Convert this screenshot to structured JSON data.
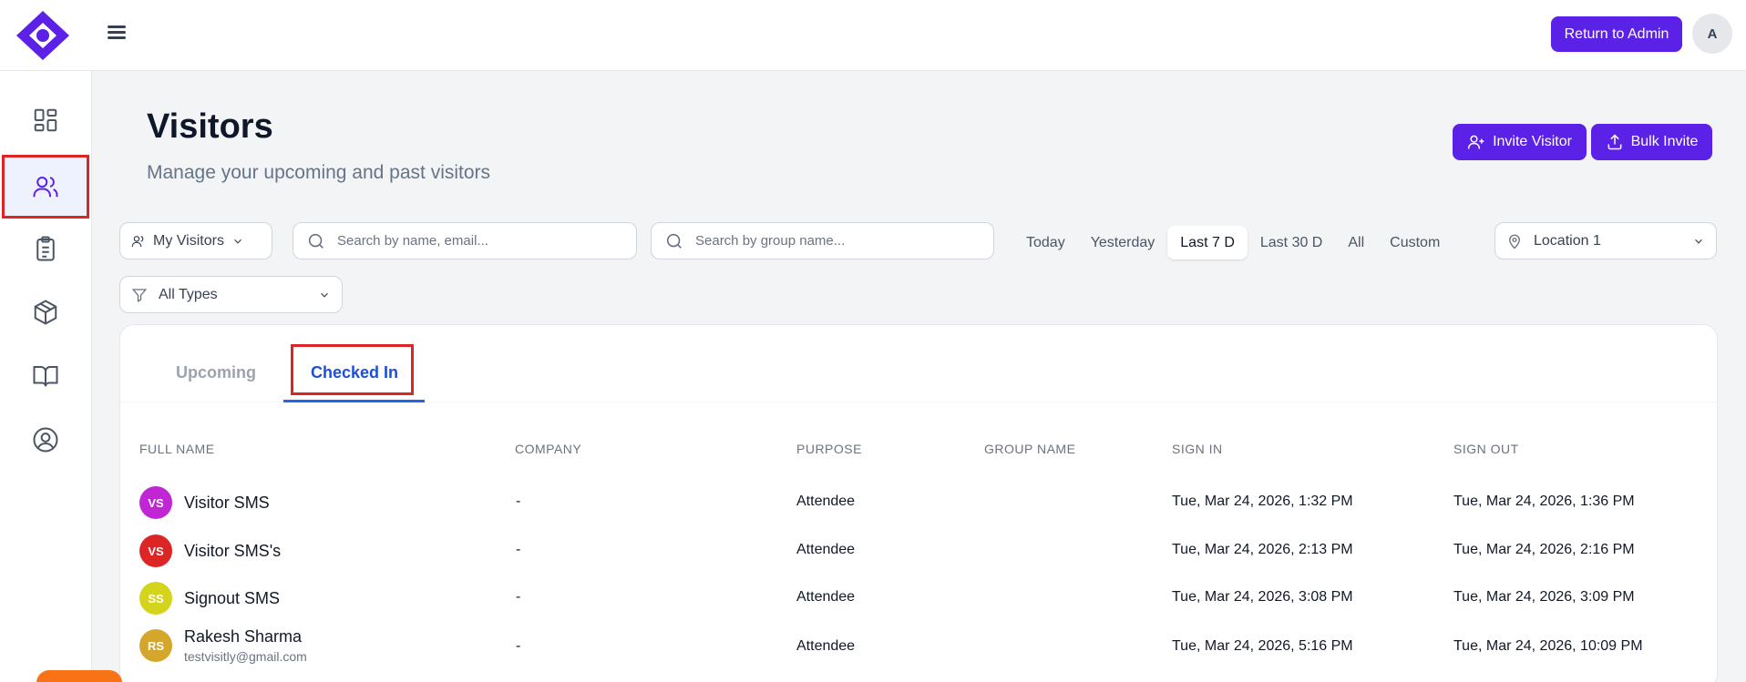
{
  "header": {
    "return_admin": "Return to Admin",
    "avatar_initial": "A"
  },
  "page": {
    "title": "Visitors",
    "subtitle": "Manage your upcoming and past visitors",
    "invite_visitor": "Invite Visitor",
    "bulk_invite": "Bulk Invite"
  },
  "filters": {
    "my_visitors": "My Visitors",
    "search_name_placeholder": "Search by name, email...",
    "search_group_placeholder": "Search by group name...",
    "date_options": [
      "Today",
      "Yesterday",
      "Last 7 D",
      "Last 30 D",
      "All",
      "Custom"
    ],
    "date_selected": "Last 7 D",
    "location": "Location 1",
    "type": "All Types"
  },
  "tabs": {
    "upcoming": "Upcoming",
    "checked_in": "Checked In",
    "active": "Checked In"
  },
  "table": {
    "columns": [
      "FULL NAME",
      "COMPANY",
      "PURPOSE",
      "GROUP NAME",
      "SIGN IN",
      "SIGN OUT"
    ],
    "rows": [
      {
        "initials": "VS",
        "avatar_color": "#c026d3",
        "name": "Visitor SMS",
        "email": "",
        "company": "-",
        "purpose": "Attendee",
        "group": "",
        "sign_in": "Tue, Mar 24, 2026, 1:32 PM",
        "sign_out": "Tue, Mar 24, 2026, 1:36 PM"
      },
      {
        "initials": "VS",
        "avatar_color": "#dc2626",
        "name": "Visitor SMS's",
        "email": "",
        "company": "-",
        "purpose": "Attendee",
        "group": "",
        "sign_in": "Tue, Mar 24, 2026, 2:13 PM",
        "sign_out": "Tue, Mar 24, 2026, 2:16 PM"
      },
      {
        "initials": "SS",
        "avatar_color": "#d4d41c",
        "name": "Signout SMS",
        "email": "",
        "company": "-",
        "purpose": "Attendee",
        "group": "",
        "sign_in": "Tue, Mar 24, 2026, 3:08 PM",
        "sign_out": "Tue, Mar 24, 2026, 3:09 PM"
      },
      {
        "initials": "RS",
        "avatar_color": "#d4a72c",
        "name": "Rakesh Sharma",
        "email": "testvisitly@gmail.com",
        "company": "-",
        "purpose": "Attendee",
        "group": "",
        "sign_in": "Tue, Mar 24, 2026, 5:16 PM",
        "sign_out": "Tue, Mar 24, 2026, 10:09 PM"
      }
    ]
  },
  "colors": {
    "brand": "#5b21e6",
    "tab_active": "#1d4ed8",
    "highlight": "#dc2626"
  }
}
